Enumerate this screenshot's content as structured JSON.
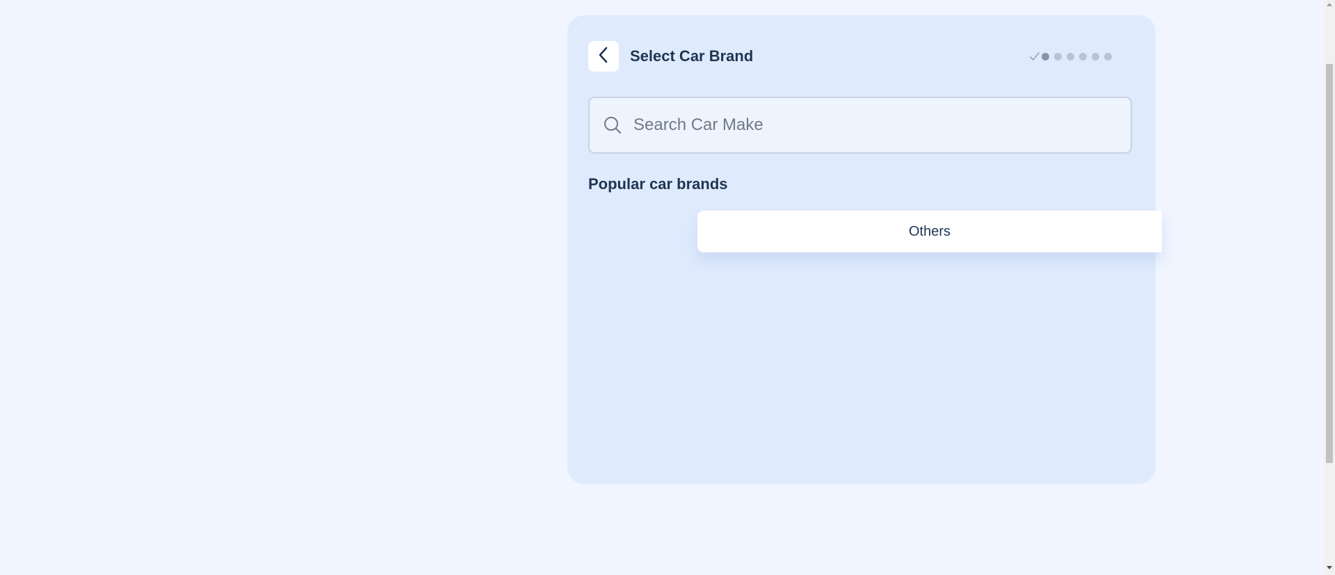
{
  "header": {
    "back_icon": "chevron-left-icon",
    "title": "Select Car Brand"
  },
  "stepper": {
    "completed_icon": "check-icon",
    "total_dots": 6,
    "active_dot": 1
  },
  "search": {
    "icon": "search-icon",
    "placeholder": "Search Car Make",
    "value": ""
  },
  "popular": {
    "title": "Popular car brands",
    "others_label": "Others"
  },
  "colors": {
    "page_background": "#f0f5ff",
    "card_background": "#dfeafd",
    "text_primary": "#1f3552",
    "placeholder": "#707a86",
    "step_active": "#8795ab",
    "step_inactive": "#b7c4d6"
  }
}
